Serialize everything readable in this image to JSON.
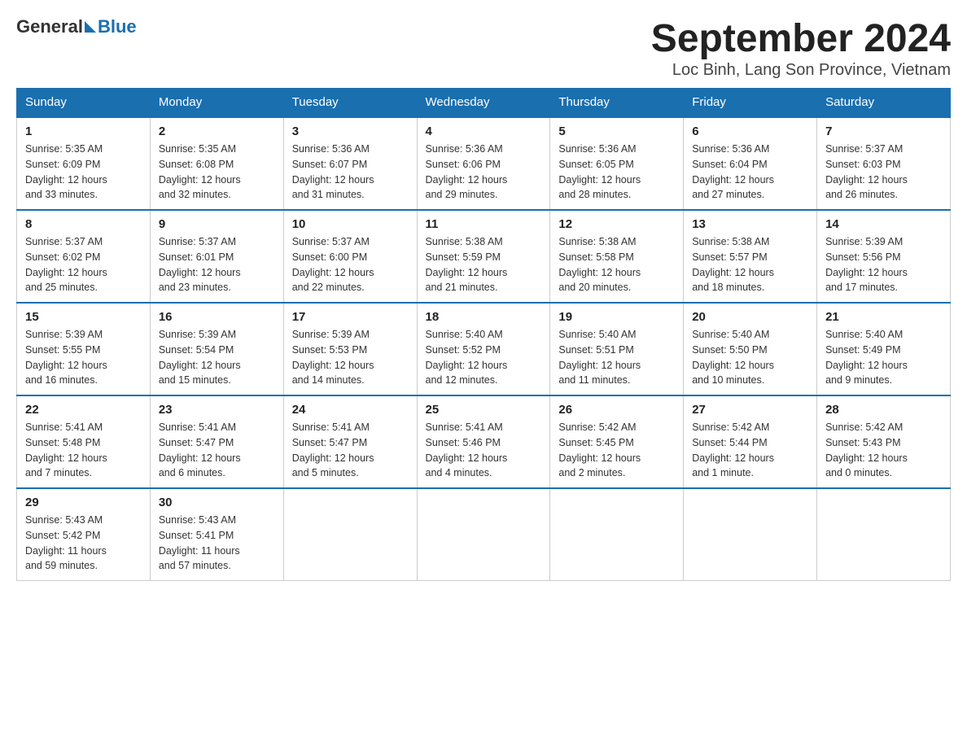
{
  "header": {
    "logo_general": "General",
    "logo_blue": "Blue",
    "month_title": "September 2024",
    "location": "Loc Binh, Lang Son Province, Vietnam"
  },
  "days_of_week": [
    "Sunday",
    "Monday",
    "Tuesday",
    "Wednesday",
    "Thursday",
    "Friday",
    "Saturday"
  ],
  "weeks": [
    [
      {
        "day": "1",
        "sunrise": "5:35 AM",
        "sunset": "6:09 PM",
        "daylight": "12 hours and 33 minutes."
      },
      {
        "day": "2",
        "sunrise": "5:35 AM",
        "sunset": "6:08 PM",
        "daylight": "12 hours and 32 minutes."
      },
      {
        "day": "3",
        "sunrise": "5:36 AM",
        "sunset": "6:07 PM",
        "daylight": "12 hours and 31 minutes."
      },
      {
        "day": "4",
        "sunrise": "5:36 AM",
        "sunset": "6:06 PM",
        "daylight": "12 hours and 29 minutes."
      },
      {
        "day": "5",
        "sunrise": "5:36 AM",
        "sunset": "6:05 PM",
        "daylight": "12 hours and 28 minutes."
      },
      {
        "day": "6",
        "sunrise": "5:36 AM",
        "sunset": "6:04 PM",
        "daylight": "12 hours and 27 minutes."
      },
      {
        "day": "7",
        "sunrise": "5:37 AM",
        "sunset": "6:03 PM",
        "daylight": "12 hours and 26 minutes."
      }
    ],
    [
      {
        "day": "8",
        "sunrise": "5:37 AM",
        "sunset": "6:02 PM",
        "daylight": "12 hours and 25 minutes."
      },
      {
        "day": "9",
        "sunrise": "5:37 AM",
        "sunset": "6:01 PM",
        "daylight": "12 hours and 23 minutes."
      },
      {
        "day": "10",
        "sunrise": "5:37 AM",
        "sunset": "6:00 PM",
        "daylight": "12 hours and 22 minutes."
      },
      {
        "day": "11",
        "sunrise": "5:38 AM",
        "sunset": "5:59 PM",
        "daylight": "12 hours and 21 minutes."
      },
      {
        "day": "12",
        "sunrise": "5:38 AM",
        "sunset": "5:58 PM",
        "daylight": "12 hours and 20 minutes."
      },
      {
        "day": "13",
        "sunrise": "5:38 AM",
        "sunset": "5:57 PM",
        "daylight": "12 hours and 18 minutes."
      },
      {
        "day": "14",
        "sunrise": "5:39 AM",
        "sunset": "5:56 PM",
        "daylight": "12 hours and 17 minutes."
      }
    ],
    [
      {
        "day": "15",
        "sunrise": "5:39 AM",
        "sunset": "5:55 PM",
        "daylight": "12 hours and 16 minutes."
      },
      {
        "day": "16",
        "sunrise": "5:39 AM",
        "sunset": "5:54 PM",
        "daylight": "12 hours and 15 minutes."
      },
      {
        "day": "17",
        "sunrise": "5:39 AM",
        "sunset": "5:53 PM",
        "daylight": "12 hours and 14 minutes."
      },
      {
        "day": "18",
        "sunrise": "5:40 AM",
        "sunset": "5:52 PM",
        "daylight": "12 hours and 12 minutes."
      },
      {
        "day": "19",
        "sunrise": "5:40 AM",
        "sunset": "5:51 PM",
        "daylight": "12 hours and 11 minutes."
      },
      {
        "day": "20",
        "sunrise": "5:40 AM",
        "sunset": "5:50 PM",
        "daylight": "12 hours and 10 minutes."
      },
      {
        "day": "21",
        "sunrise": "5:40 AM",
        "sunset": "5:49 PM",
        "daylight": "12 hours and 9 minutes."
      }
    ],
    [
      {
        "day": "22",
        "sunrise": "5:41 AM",
        "sunset": "5:48 PM",
        "daylight": "12 hours and 7 minutes."
      },
      {
        "day": "23",
        "sunrise": "5:41 AM",
        "sunset": "5:47 PM",
        "daylight": "12 hours and 6 minutes."
      },
      {
        "day": "24",
        "sunrise": "5:41 AM",
        "sunset": "5:47 PM",
        "daylight": "12 hours and 5 minutes."
      },
      {
        "day": "25",
        "sunrise": "5:41 AM",
        "sunset": "5:46 PM",
        "daylight": "12 hours and 4 minutes."
      },
      {
        "day": "26",
        "sunrise": "5:42 AM",
        "sunset": "5:45 PM",
        "daylight": "12 hours and 2 minutes."
      },
      {
        "day": "27",
        "sunrise": "5:42 AM",
        "sunset": "5:44 PM",
        "daylight": "12 hours and 1 minute."
      },
      {
        "day": "28",
        "sunrise": "5:42 AM",
        "sunset": "5:43 PM",
        "daylight": "12 hours and 0 minutes."
      }
    ],
    [
      {
        "day": "29",
        "sunrise": "5:43 AM",
        "sunset": "5:42 PM",
        "daylight": "11 hours and 59 minutes."
      },
      {
        "day": "30",
        "sunrise": "5:43 AM",
        "sunset": "5:41 PM",
        "daylight": "11 hours and 57 minutes."
      },
      null,
      null,
      null,
      null,
      null
    ]
  ],
  "labels": {
    "sunrise": "Sunrise:",
    "sunset": "Sunset:",
    "daylight": "Daylight:"
  }
}
